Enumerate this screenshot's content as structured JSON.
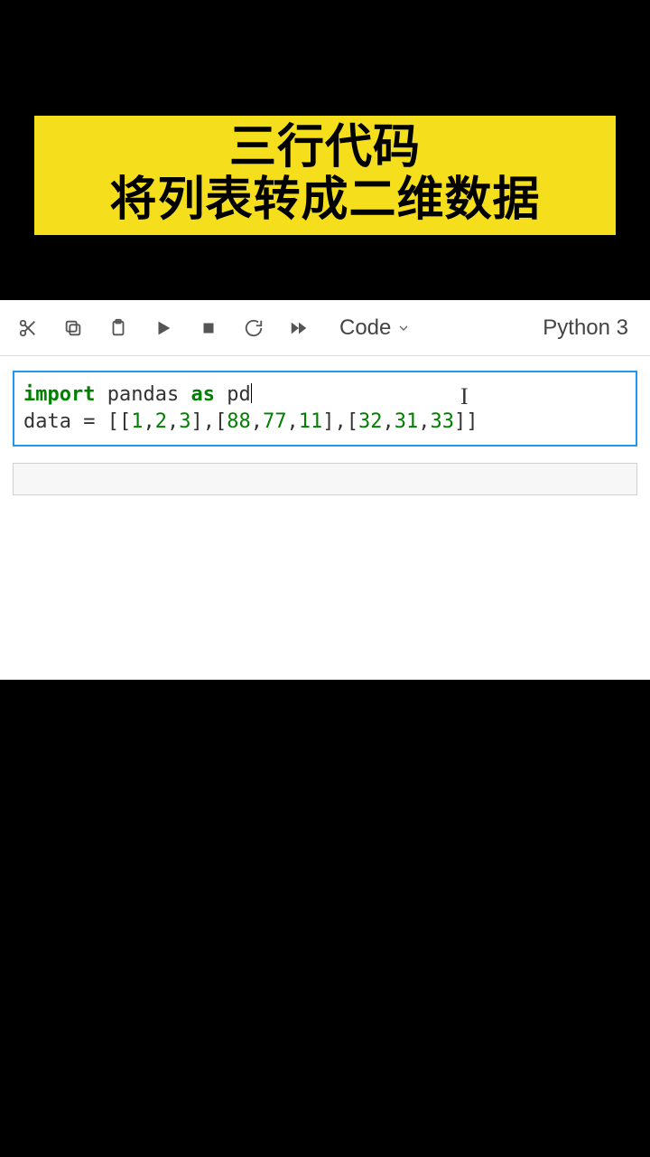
{
  "banner": {
    "line1": "三行代码",
    "line2": "将列表转成二维数据"
  },
  "toolbar": {
    "celltype": "Code",
    "kernel": "Python 3"
  },
  "code": {
    "l1": {
      "t0": "import",
      "t1": "pandas",
      "t2": "as",
      "t3": "pd"
    },
    "l2": {
      "t0": "data = ",
      "n0": "1",
      "n1": "2",
      "n2": "3",
      "n3": "88",
      "n4": "77",
      "n5": "11",
      "n6": "32",
      "n7": "31",
      "n8": "33"
    }
  },
  "cursor": {
    "glyph": "I"
  }
}
